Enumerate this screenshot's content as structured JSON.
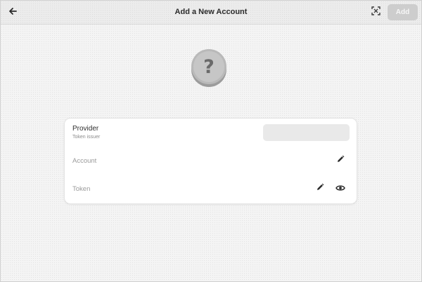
{
  "header": {
    "title": "Add a New Account",
    "add_label": "Add"
  },
  "provider_logo": {
    "glyph": "?",
    "icon": "question-mark-icon"
  },
  "form": {
    "provider": {
      "title": "Provider",
      "subtitle": "Token issuer",
      "value": ""
    },
    "account": {
      "label": "Account"
    },
    "token": {
      "label": "Token"
    }
  },
  "icons": {
    "back": "back-arrow-icon",
    "scan": "qr-scan-icon",
    "edit": "pencil-icon",
    "reveal": "eye-icon"
  },
  "colors": {
    "add_button_bg": "#cdcdcd",
    "card_bg": "#ffffff",
    "provider_field_bg": "#e9e9e9"
  }
}
